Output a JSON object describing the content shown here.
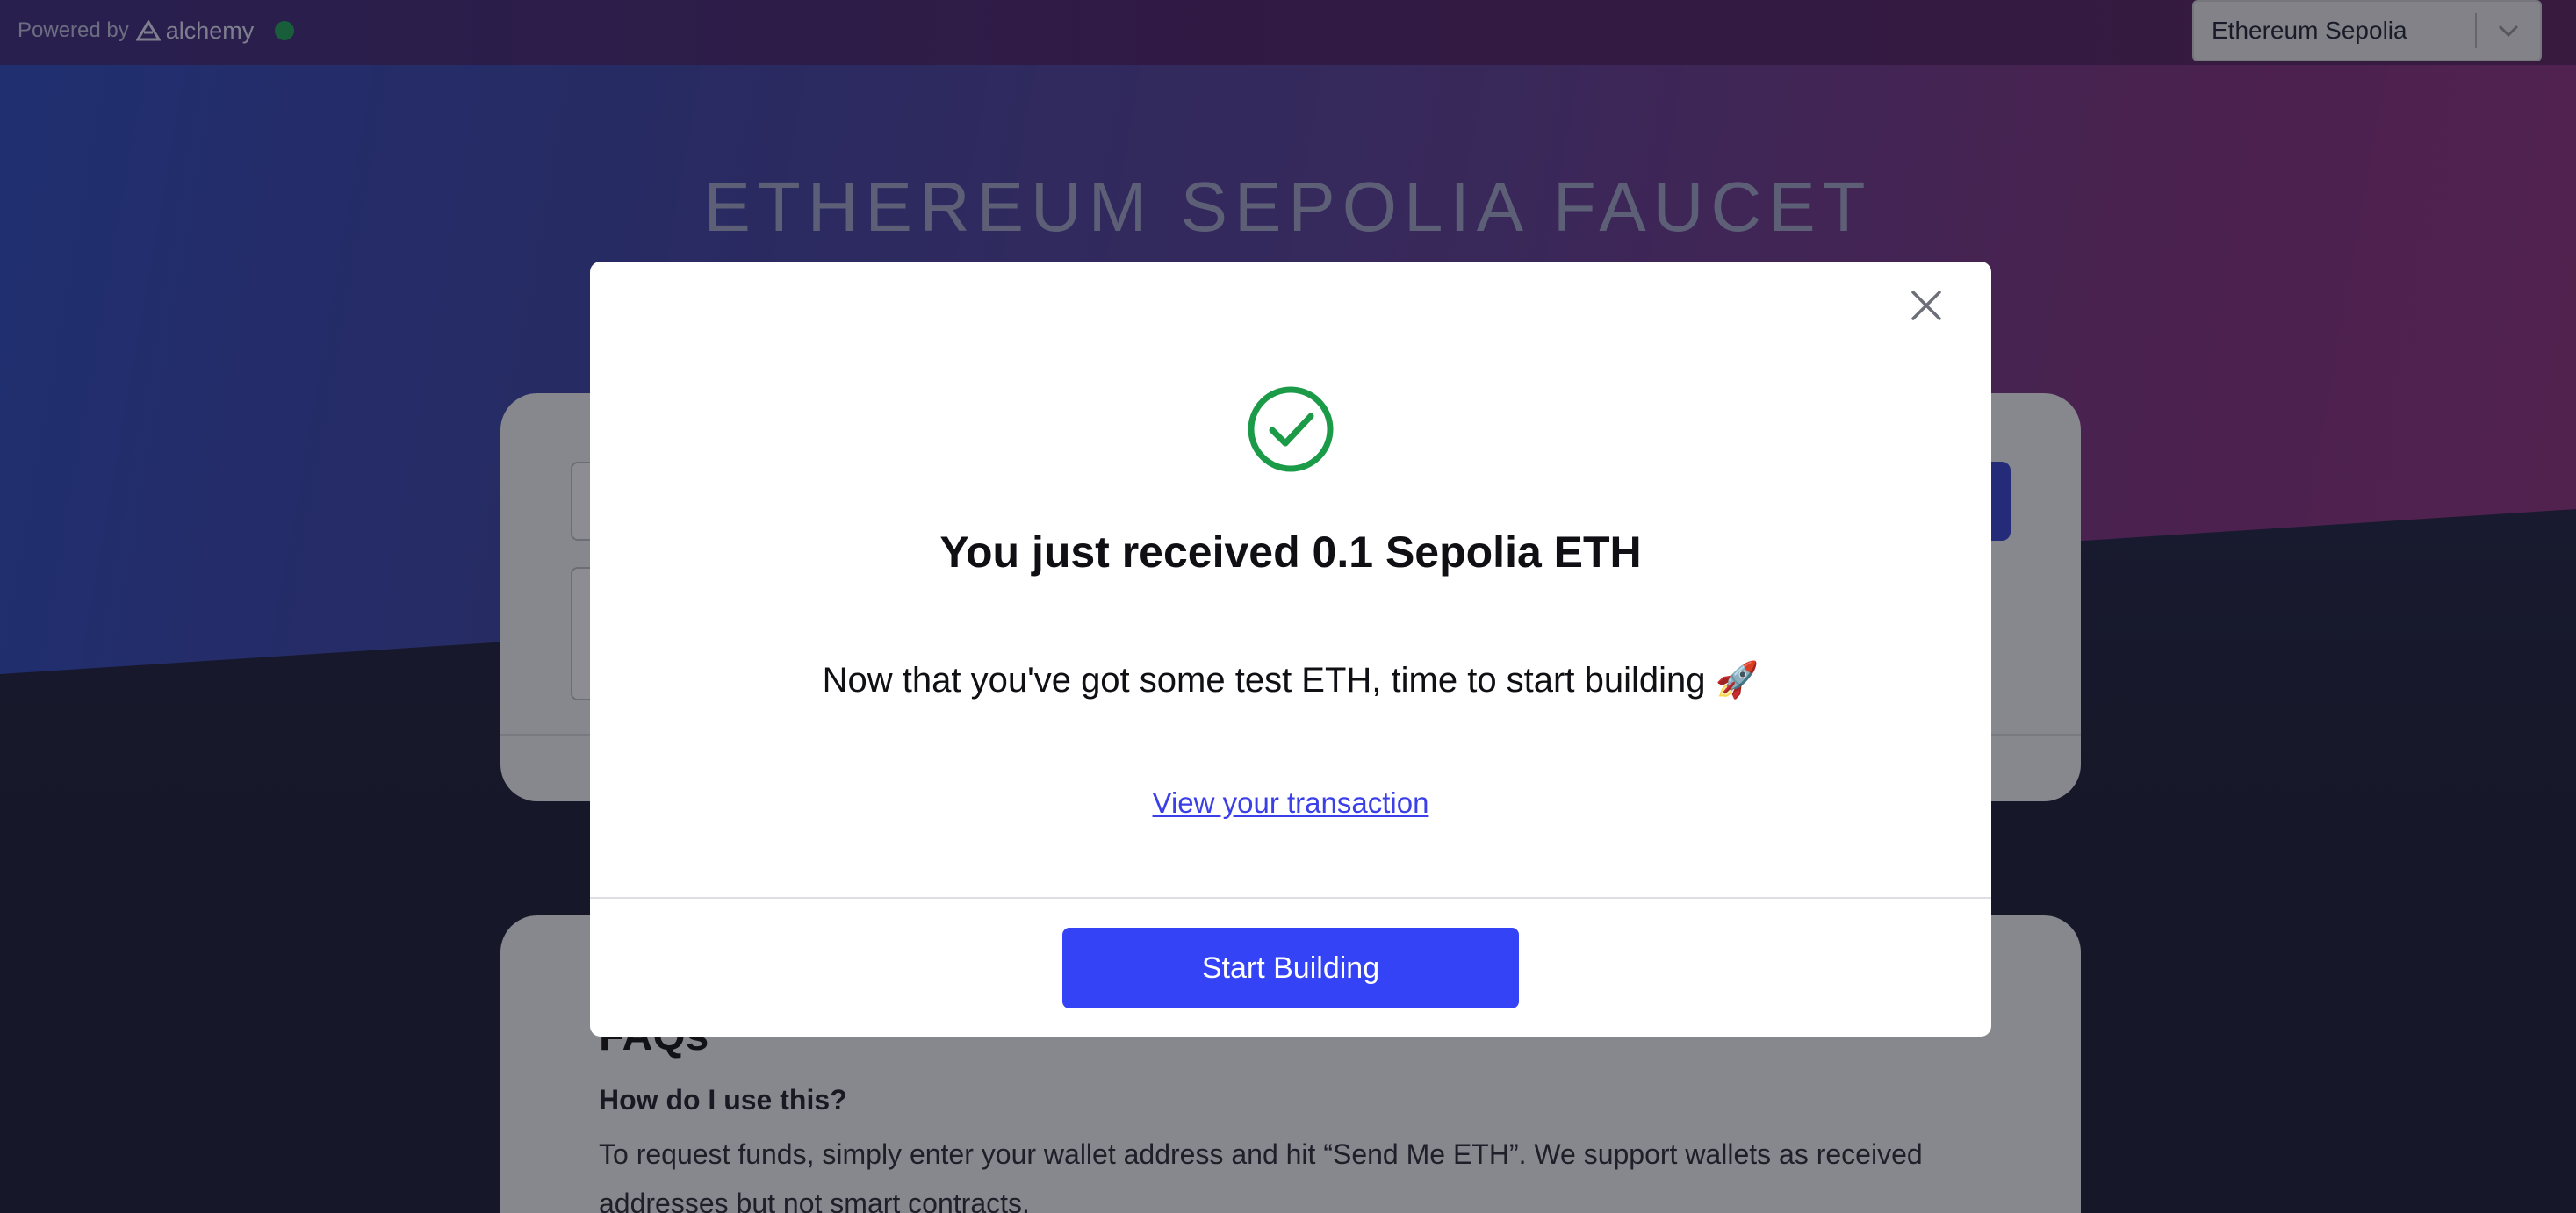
{
  "topbar": {
    "powered_by": "Powered by",
    "brand": "alchemy",
    "network": {
      "selected": "Ethereum Sepolia"
    }
  },
  "page": {
    "title": "ETHEREUM SEPOLIA FAUCET"
  },
  "faq": {
    "title": "FAQs",
    "question": "How do I use this?",
    "answer": "To request funds, simply enter your wallet address and hit “Send Me ETH”. We support wallets as received addresses but not smart contracts."
  },
  "modal": {
    "heading": "You just received 0.1 Sepolia ETH",
    "subtext": "Now that you've got some test ETH, time to start building 🚀",
    "link_label": "View your transaction",
    "button_label": "Start Building"
  },
  "colors": {
    "accent": "#3343f5",
    "success": "#1b9a48",
    "status_dot": "#1f9d55",
    "link": "#3b3fe8"
  },
  "icons": [
    "alchemy-logo-icon",
    "chevron-down-icon",
    "close-icon",
    "check-circle-icon"
  ]
}
